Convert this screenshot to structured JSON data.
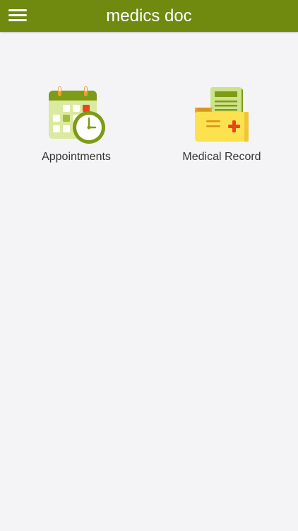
{
  "header": {
    "title": "medics doc",
    "background_color": "#6f8a0e",
    "menu_icon": "hamburger-menu-icon"
  },
  "tiles": [
    {
      "label": "Appointments",
      "icon": "calendar-clock-icon"
    },
    {
      "label": "Medical Record",
      "icon": "medical-folder-icon"
    }
  ]
}
